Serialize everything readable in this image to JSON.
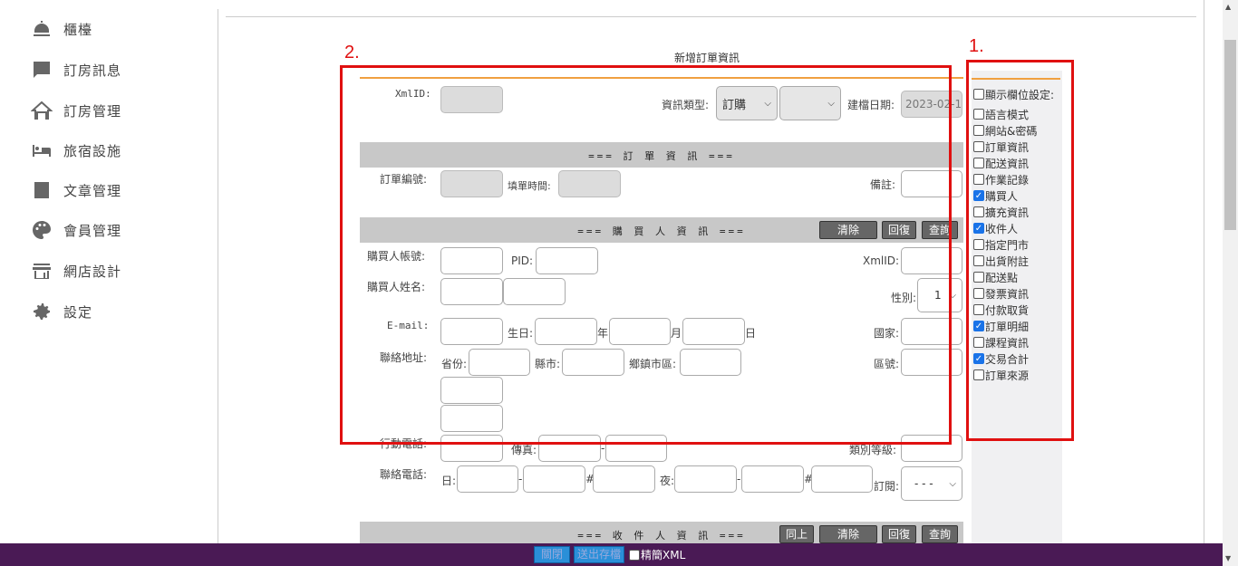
{
  "sidebar": {
    "items": [
      {
        "label": "櫃檯",
        "icon": "counter-bell-icon"
      },
      {
        "label": "訂房訊息",
        "icon": "message-icon"
      },
      {
        "label": "訂房管理",
        "icon": "house-icon"
      },
      {
        "label": "旅宿設施",
        "icon": "bed-icon"
      },
      {
        "label": "文章管理",
        "icon": "article-icon"
      },
      {
        "label": "會員管理",
        "icon": "palette-icon"
      },
      {
        "label": "網店設計",
        "icon": "store-icon"
      },
      {
        "label": "設定",
        "icon": "gear-icon"
      }
    ]
  },
  "form": {
    "title": "新增訂單資訊",
    "xmlid_label": "XmlID:",
    "info_type_label": "資訊類型:",
    "info_type_value": "訂購",
    "create_date_label": "建檔日期:",
    "create_date_value": "2023-02-1",
    "order_section": {
      "title": "=== 訂 單 資 訊 ===",
      "order_no_label": "訂單編號:",
      "fill_time_label": "填單時間:",
      "note_label": "備註:"
    },
    "buyer_section": {
      "title": "=== 購 買 人 資 訊 ===",
      "btn_clear": "清除",
      "btn_restore": "回復",
      "btn_query": "查詢",
      "account_label": "購買人帳號:",
      "pid_label": "PID:",
      "xmlid_label": "XmlID:",
      "name_label": "購買人姓名:",
      "gender_label": "性別:",
      "gender_value": "1",
      "email_label": "E-mail:",
      "birthday_label": "生日:",
      "year_label": "年",
      "month_label": "月",
      "day_label": "日",
      "country_label": "國家:",
      "address_label": "聯絡地址:",
      "province_label": "省份:",
      "city_label": "縣市:",
      "district_label": "鄉鎮市區:",
      "zip_label": "區號:",
      "mobile_label": "行動電話:",
      "fax_label": "傳真:",
      "dash": "-",
      "level_label": "類別等級:",
      "phone_label": "聯絡電話:",
      "phone_day_label": "日:",
      "phone_night_label": "夜:",
      "hash": "#",
      "subscribe_label": "訂閱:",
      "subscribe_value": "- - -"
    },
    "receiver_section": {
      "title": "=== 收 件 人 資 訊 ===",
      "btn_same": "同上",
      "btn_clear": "清除",
      "btn_restore": "回復",
      "btn_query": "查詢"
    }
  },
  "field_panel": {
    "header": "顯示欄位設定:",
    "items": [
      {
        "label": "語言模式",
        "checked": false
      },
      {
        "label": "網站&密碼",
        "checked": false
      },
      {
        "label": "訂單資訊",
        "checked": false
      },
      {
        "label": "配送資訊",
        "checked": false
      },
      {
        "label": "作業記錄",
        "checked": false
      },
      {
        "label": "購買人",
        "checked": true
      },
      {
        "label": "擴充資訊",
        "checked": false
      },
      {
        "label": "收件人",
        "checked": true
      },
      {
        "label": "指定門市",
        "checked": false
      },
      {
        "label": "出貨附註",
        "checked": false
      },
      {
        "label": "配送點",
        "checked": false
      },
      {
        "label": "發票資訊",
        "checked": false
      },
      {
        "label": "付款取貨",
        "checked": false
      },
      {
        "label": "訂單明細",
        "checked": true
      },
      {
        "label": "課程資訊",
        "checked": false
      },
      {
        "label": "交易合計",
        "checked": true
      },
      {
        "label": "訂單來源",
        "checked": false
      }
    ]
  },
  "annotations": {
    "label1": "1.",
    "label2": "2."
  },
  "footer": {
    "btn_close": "關閉",
    "btn_send": "送出存檔",
    "xml_label": "精簡XML"
  },
  "colors": {
    "annotation_red": "#e01010",
    "accent_orange": "#f0a040",
    "footer_purple": "#4a1a55",
    "checkbox_blue": "#1a73e8"
  }
}
